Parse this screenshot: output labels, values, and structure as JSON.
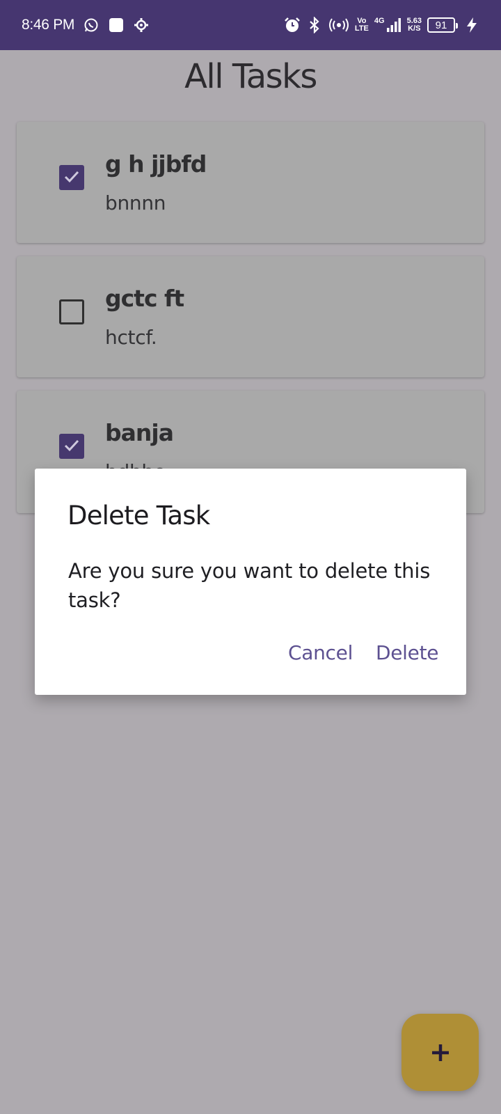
{
  "status_bar": {
    "time": "8:46 PM",
    "icons": [
      "whatsapp-icon",
      "square-notification-icon",
      "gear-icon",
      "alarm-icon",
      "bluetooth-icon",
      "hotspot-icon",
      "volte-icon",
      "signal-icon",
      "battery-icon",
      "charging-icon"
    ],
    "volte_top": "Vo",
    "volte_bottom": "LTE",
    "network_type": "4G",
    "net_speed_value": "5.63",
    "net_speed_unit": "K/S",
    "battery_level": "91"
  },
  "page": {
    "title": "All Tasks"
  },
  "tasks": [
    {
      "title": "g h jjbfd",
      "description": "bnnnn",
      "checked": true
    },
    {
      "title": "gctc ft",
      "description": "hctcf.",
      "checked": false
    },
    {
      "title": "banja",
      "description": "bdbhe",
      "checked": true
    }
  ],
  "dialog": {
    "title": "Delete Task",
    "message": "Are you sure you want to delete this task?",
    "cancel_label": "Cancel",
    "delete_label": "Delete"
  },
  "fab": {
    "icon": "plus-icon"
  },
  "colors": {
    "status_bar": "#463670",
    "accent": "#46386e",
    "fab": "#af8f36",
    "dialog_button": "#5d5191"
  }
}
